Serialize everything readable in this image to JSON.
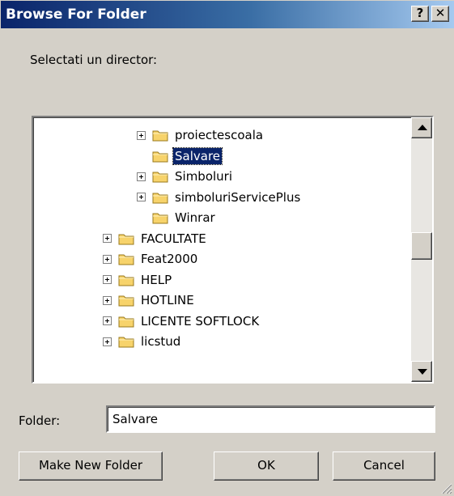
{
  "window": {
    "title": "Browse For Folder",
    "help_label": "?",
    "close_label": "✕"
  },
  "prompt": "Selectati un director:",
  "tree": {
    "items": [
      {
        "label": "proiectescoala",
        "expandable": true,
        "selected": false
      },
      {
        "label": "Salvare",
        "expandable": false,
        "selected": true
      },
      {
        "label": "Simboluri",
        "expandable": true,
        "selected": false
      },
      {
        "label": "simboluriServicePlus",
        "expandable": true,
        "selected": false
      },
      {
        "label": "Winrar",
        "expandable": false,
        "selected": false
      },
      {
        "label": "FACULTATE",
        "expandable": true,
        "selected": false
      },
      {
        "label": "Feat2000",
        "expandable": true,
        "selected": false
      },
      {
        "label": "HELP",
        "expandable": true,
        "selected": false
      },
      {
        "label": "HOTLINE",
        "expandable": true,
        "selected": false
      },
      {
        "label": "LICENTE SOFTLOCK",
        "expandable": true,
        "selected": false
      },
      {
        "label": "licstud",
        "expandable": true,
        "selected": false
      }
    ]
  },
  "folder_field": {
    "label": "Folder:",
    "value": "Salvare"
  },
  "buttons": {
    "make_new_folder": "Make New Folder",
    "ok": "OK",
    "cancel": "Cancel"
  },
  "colors": {
    "selection": "#0a246a",
    "dialog_bg": "#d4d0c8",
    "folder_yellow": "#f7d36b"
  }
}
